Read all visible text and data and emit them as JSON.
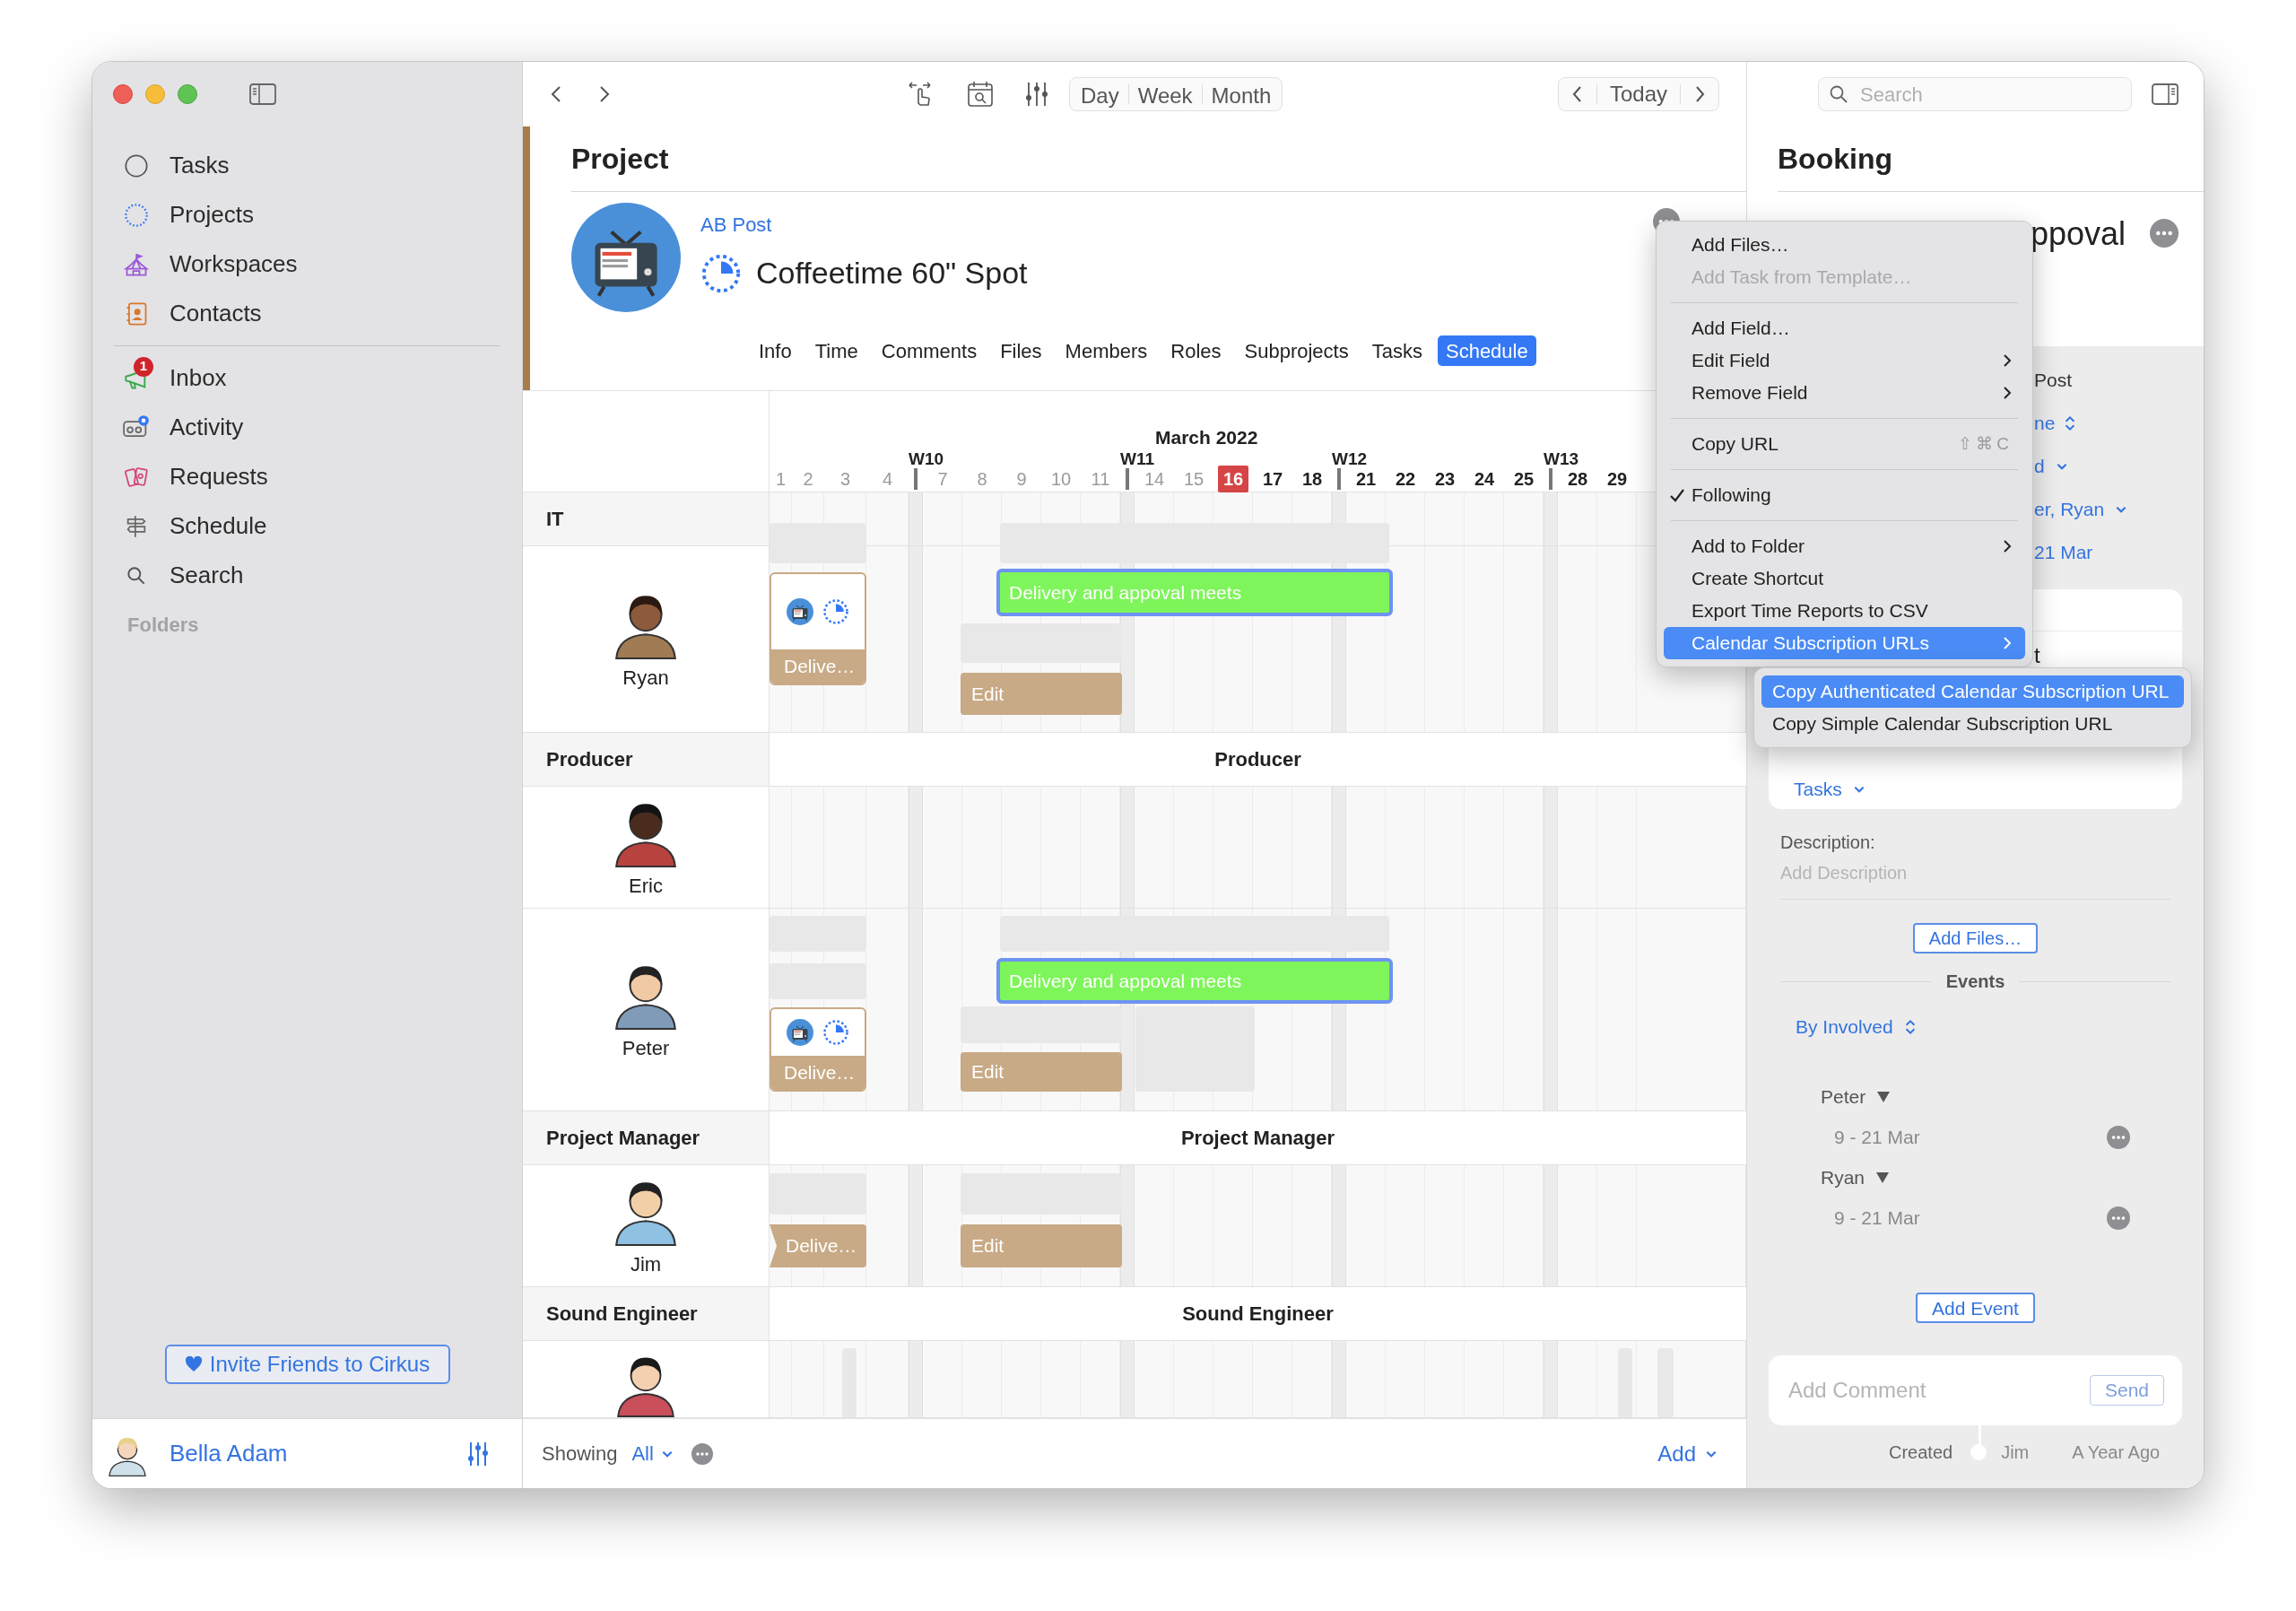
{
  "sidebar": {
    "groups": [
      [
        {
          "label": "Tasks",
          "selected": false
        },
        {
          "label": "Projects",
          "selected": false
        },
        {
          "label": "Workspaces",
          "selected": false
        },
        {
          "label": "Contacts",
          "selected": false
        }
      ],
      [
        {
          "label": "Inbox",
          "badge": "1",
          "selected": false
        },
        {
          "label": "Activity",
          "selected": false
        },
        {
          "label": "Requests",
          "selected": false
        },
        {
          "label": "Schedule",
          "selected": false
        },
        {
          "label": "Search",
          "selected": false
        }
      ]
    ],
    "section": "Folders",
    "invite_button": "Invite Friends to Cirkus",
    "user": "Bella Adam"
  },
  "toolbar": {
    "views": [
      {
        "label": "Day",
        "selected": false
      },
      {
        "label": "Week",
        "selected": false
      },
      {
        "label": "Month",
        "selected": false
      }
    ],
    "today": "Today"
  },
  "project": {
    "heading": "Project",
    "client": "AB Post",
    "title": "Coffeetime 60\" Spot",
    "tabs": [
      {
        "label": "Info",
        "selected": false
      },
      {
        "label": "Time",
        "selected": false
      },
      {
        "label": "Comments",
        "selected": false
      },
      {
        "label": "Files",
        "selected": false
      },
      {
        "label": "Members",
        "selected": false
      },
      {
        "label": "Roles",
        "selected": false
      },
      {
        "label": "Subprojects",
        "selected": false
      },
      {
        "label": "Tasks",
        "selected": false
      },
      {
        "label": "Schedule",
        "selected": true
      }
    ]
  },
  "schedule": {
    "month": "March 2022",
    "weeks": [
      {
        "days": [
          {
            "label": "1",
            "past": true,
            "today": false
          },
          {
            "label": "2",
            "past": true,
            "today": false
          },
          {
            "label": "3",
            "past": true,
            "today": false
          },
          {
            "label": "4",
            "past": true,
            "today": false
          }
        ]
      },
      {
        "label": "W10",
        "days": [
          {
            "label": "7",
            "past": true,
            "today": false
          },
          {
            "label": "8",
            "past": true,
            "today": false
          },
          {
            "label": "9",
            "past": true,
            "today": false
          },
          {
            "label": "10",
            "past": true,
            "today": false
          },
          {
            "label": "11",
            "past": true,
            "today": false
          }
        ]
      },
      {
        "label": "W11",
        "days": [
          {
            "label": "14",
            "past": true,
            "today": false
          },
          {
            "label": "15",
            "past": true,
            "today": false
          },
          {
            "label": "16",
            "past": false,
            "today": true
          },
          {
            "label": "17",
            "past": false,
            "today": false
          },
          {
            "label": "18",
            "past": false,
            "today": false
          }
        ]
      },
      {
        "label": "W12",
        "days": [
          {
            "label": "21",
            "past": false,
            "today": false
          },
          {
            "label": "22",
            "past": false,
            "today": false
          },
          {
            "label": "23",
            "past": false,
            "today": false
          },
          {
            "label": "24",
            "past": false,
            "today": false
          },
          {
            "label": "25",
            "past": false,
            "today": false
          }
        ]
      },
      {
        "label": "W13",
        "days": [
          {
            "label": "28",
            "past": false,
            "today": false
          },
          {
            "label": "29",
            "past": false,
            "today": false
          }
        ]
      }
    ],
    "groups": [
      {
        "role": "IT",
        "rows": [
          {
            "name": "Ryan",
            "events": [
              {
                "kind": "placeholder"
              },
              {
                "kind": "placeholder"
              },
              {
                "kind": "booking",
                "label": "Delivery and appoval meets",
                "selected": true
              },
              {
                "kind": "project",
                "label": "Delive…"
              },
              {
                "kind": "placeholder"
              },
              {
                "kind": "task",
                "label": "Edit"
              }
            ]
          }
        ]
      },
      {
        "role": "Producer",
        "timeline_label": "Producer",
        "rows": [
          {
            "name": "Eric"
          },
          {
            "name": "Peter",
            "events": [
              {
                "kind": "placeholder"
              },
              {
                "kind": "placeholder"
              },
              {
                "kind": "placeholder"
              },
              {
                "kind": "booking",
                "label": "Delivery and appoval meets",
                "selected": true
              },
              {
                "kind": "project",
                "label": "Delive…"
              },
              {
                "kind": "placeholder"
              },
              {
                "kind": "task",
                "label": "Edit"
              },
              {
                "kind": "placeholder"
              }
            ]
          }
        ]
      },
      {
        "role": "Project Manager",
        "timeline_label": "Project Manager",
        "rows": [
          {
            "name": "Jim",
            "events": [
              {
                "kind": "placeholder"
              },
              {
                "kind": "placeholder"
              },
              {
                "kind": "milestone",
                "label": "Delive…"
              },
              {
                "kind": "task",
                "label": "Edit"
              }
            ]
          }
        ]
      },
      {
        "role": "Sound Engineer",
        "timeline_label": "Sound Engineer",
        "rows": [
          {
            "events": [
              {
                "kind": "placeholder"
              },
              {
                "kind": "placeholder"
              },
              {
                "kind": "placeholder"
              }
            ]
          }
        ]
      }
    ]
  },
  "footer": {
    "showing": "Showing",
    "filter": "All",
    "add": "Add"
  },
  "context_menu": {
    "groups": [
      [
        {
          "label": "Add Files…",
          "disabled": false,
          "checked": false,
          "submenu": false,
          "selected": false
        },
        {
          "label": "Add Task from Template…",
          "disabled": true,
          "checked": false,
          "submenu": false,
          "selected": false
        }
      ],
      [
        {
          "label": "Add Field…",
          "disabled": false,
          "checked": false,
          "submenu": false,
          "selected": false
        },
        {
          "label": "Edit Field",
          "disabled": false,
          "checked": false,
          "submenu": true,
          "selected": false
        },
        {
          "label": "Remove Field",
          "disabled": false,
          "checked": false,
          "submenu": true,
          "selected": false
        }
      ],
      [
        {
          "label": "Copy URL",
          "shortcut": "⇧⌘C",
          "disabled": false,
          "checked": false,
          "submenu": false,
          "selected": false
        }
      ],
      [
        {
          "label": "Following",
          "disabled": false,
          "checked": true,
          "submenu": false,
          "selected": false
        }
      ],
      [
        {
          "label": "Add to Folder",
          "disabled": false,
          "checked": false,
          "submenu": true,
          "selected": false
        },
        {
          "label": "Create Shortcut",
          "disabled": false,
          "checked": false,
          "submenu": false,
          "selected": false
        },
        {
          "label": "Export Time Reports to CSV",
          "disabled": false,
          "checked": false,
          "submenu": false,
          "selected": false
        },
        {
          "label": "Calendar Subscription URLs",
          "disabled": false,
          "checked": false,
          "submenu": true,
          "selected": true
        }
      ]
    ]
  },
  "submenu": {
    "items": [
      {
        "label": "Copy Authenticated Calendar Subscription URL",
        "selected": true
      },
      {
        "label": "Copy Simple Calendar Subscription URL",
        "selected": false
      }
    ]
  },
  "detail": {
    "search_placeholder": "Search",
    "heading": "Booking",
    "title_fragment": "ppoval",
    "fields": [
      {
        "kind": "text",
        "value": "Post"
      },
      {
        "kind": "stepper",
        "value": "ne"
      },
      {
        "kind": "popup",
        "value": "d"
      },
      {
        "kind": "popup",
        "value": "er, Ryan"
      },
      {
        "kind": "link",
        "value": "21 Mar"
      }
    ],
    "card_fragment": "t",
    "tasks_link": "Tasks",
    "description_label": "Description:",
    "description_placeholder": "Add Description",
    "add_files": "Add Files…",
    "events_heading": "Events",
    "sort": "By Involved",
    "people": [
      {
        "name": "Peter",
        "range": "9 - 21 Mar"
      },
      {
        "name": "Ryan",
        "range": "9 - 21 Mar"
      }
    ],
    "add_event": "Add Event",
    "comment_placeholder": "Add Comment",
    "send": "Send",
    "created": {
      "label": "Created",
      "by": "Jim",
      "when": "A Year Ago"
    }
  }
}
